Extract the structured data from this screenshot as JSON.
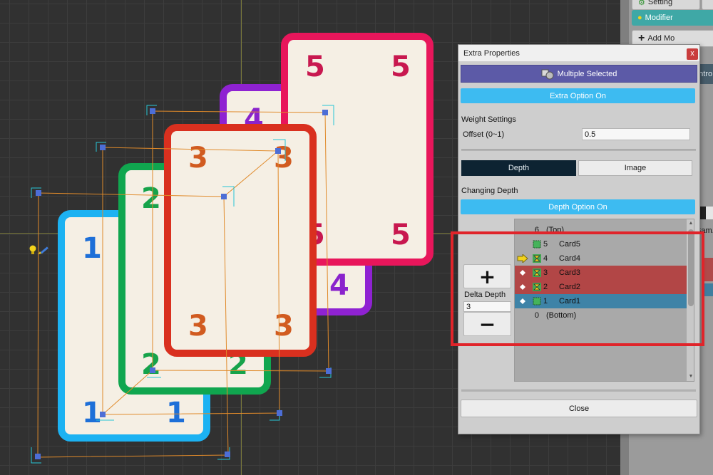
{
  "canvas": {
    "cards": [
      {
        "id": "card1",
        "name": "Card1",
        "numbers": [
          "1",
          "1",
          "1"
        ],
        "border_color": "#1cb2f2",
        "text_color": "#1d6fd8"
      },
      {
        "id": "card2",
        "name": "Card2",
        "numbers": [
          "2",
          "2",
          "2"
        ],
        "border_color": "#10a64f",
        "text_color": "#16a34a"
      },
      {
        "id": "card4",
        "name": "Card4",
        "numbers": [
          "4",
          "4"
        ],
        "border_color": "#8f22d2",
        "text_color": "#8a23cc"
      },
      {
        "id": "card5",
        "name": "Card5",
        "numbers": [
          "5",
          "5",
          "5",
          "5"
        ],
        "border_color": "#e8165b",
        "text_color": "#c8184f"
      },
      {
        "id": "card3",
        "name": "Card3",
        "numbers": [
          "3",
          "3",
          "3",
          "3"
        ],
        "border_color": "#d9301f",
        "text_color": "#d15b20"
      }
    ],
    "icons": [
      "bulb-icon",
      "pencil-icon"
    ]
  },
  "inspector": {
    "setting_label": "Setting",
    "modifier_label": "Modifier",
    "add_modifier_label": "Add Mo",
    "control_label": "ontro",
    "sample_label": "Sam."
  },
  "dialog": {
    "title": "Extra Properties",
    "close_x": "x",
    "multiple_selected": "Multiple Selected",
    "extra_option_button": "Extra Option On",
    "weight_settings_label": "Weight Settings",
    "offset_label": "Offset (0~1)",
    "offset_value": "0.5",
    "tabs": {
      "depth": "Depth",
      "image": "Image"
    },
    "changing_depth_label": "Changing Depth",
    "depth_option_button": "Depth Option On",
    "delta_depth_label": "Delta Depth",
    "delta_depth_value": "3",
    "plus_symbol": "+",
    "minus_symbol": "−",
    "depth_rows": [
      {
        "depth": "6",
        "name": "(Top)",
        "state": "plain"
      },
      {
        "depth": "5",
        "name": "Card5",
        "state": "normal",
        "icon": "green-square-icon"
      },
      {
        "depth": "4",
        "name": "Card4",
        "state": "normal",
        "icon": "hourglass-icon",
        "marker": "arrow-marker-icon"
      },
      {
        "depth": "3",
        "name": "Card3",
        "state": "selected-red",
        "icon": "hourglass-icon",
        "marker": "diamond-icon"
      },
      {
        "depth": "2",
        "name": "Card2",
        "state": "selected-red",
        "icon": "hourglass-icon",
        "marker": "diamond-icon"
      },
      {
        "depth": "1",
        "name": "Card1",
        "state": "selected-blue",
        "icon": "green-square-icon",
        "marker": "diamond-icon"
      },
      {
        "depth": "0",
        "name": "(Bottom)",
        "state": "plain"
      }
    ],
    "close_button": "Close"
  },
  "colors": {
    "accent_blue": "#3dbbf1",
    "selected_red": "#b24646",
    "selected_blue": "#3e83a7",
    "multi_select_purple": "#5c5aa7",
    "highlight_red": "#e0242a"
  }
}
